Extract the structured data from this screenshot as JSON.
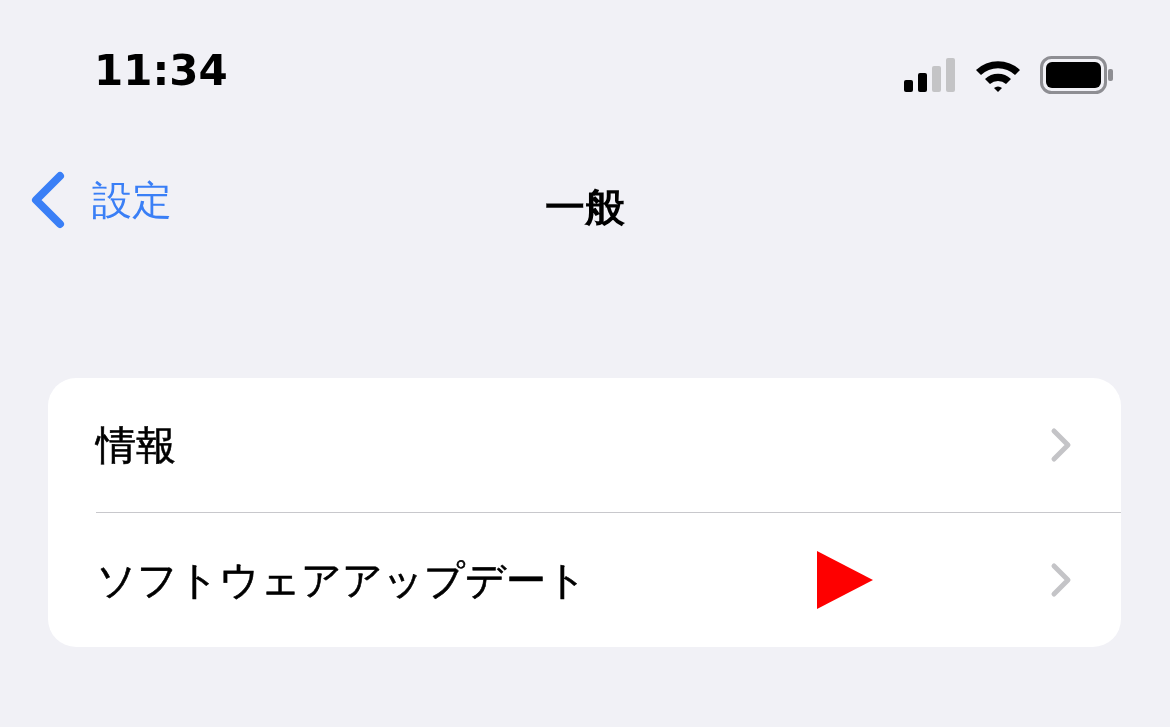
{
  "status_bar": {
    "time": "11:34"
  },
  "navigation": {
    "back_label": "設定",
    "title": "一般"
  },
  "rows": [
    {
      "label": "情報",
      "marked": false
    },
    {
      "label": "ソフトウェアアップデート",
      "marked": true
    }
  ]
}
